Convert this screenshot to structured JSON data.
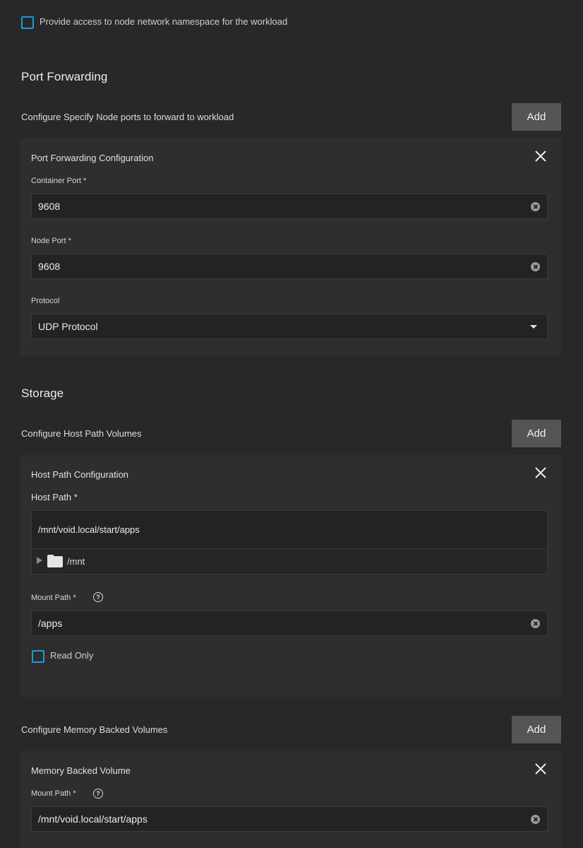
{
  "network": {
    "host_network_checkbox_label": "Provide access to node network namespace for the workload"
  },
  "port_forwarding": {
    "section_title": "Port Forwarding",
    "row_label": "Configure Specify Node ports to forward to workload",
    "add_label": "Add",
    "panel": {
      "title": "Port Forwarding Configuration",
      "container_port_label": "Container Port *",
      "container_port_value": "9608",
      "node_port_label": "Node Port *",
      "node_port_value": "9608",
      "protocol_label": "Protocol",
      "protocol_value": "UDP Protocol"
    }
  },
  "storage": {
    "section_title": "Storage",
    "host_path_row_label": "Configure Host Path Volumes",
    "add_label": "Add",
    "host_path_panel": {
      "title": "Host Path Configuration",
      "host_path_label": "Host Path *",
      "host_path_value": "/mnt/void.local/start/apps",
      "tree_item": "/mnt",
      "mount_path_label": "Mount Path *",
      "mount_path_value": "/apps",
      "read_only_label": "Read Only"
    },
    "memory_row_label": "Configure Memory Backed Volumes",
    "memory_panel": {
      "title": "Memory Backed Volume",
      "mount_path_label": "Mount Path *",
      "mount_path_value": "/mnt/void.local/start/apps"
    }
  },
  "colors": {
    "background": "#282828",
    "panel": "#2e2e2e",
    "input": "#232323",
    "button": "#555555",
    "checkbox_accent": "#1f9bd3"
  },
  "icons": {
    "close": "close-icon",
    "clear": "clear-circle-icon",
    "dropdown": "caret-down-icon",
    "help": "help-circle-icon",
    "folder": "folder-icon",
    "expand": "triangle-right-icon"
  }
}
